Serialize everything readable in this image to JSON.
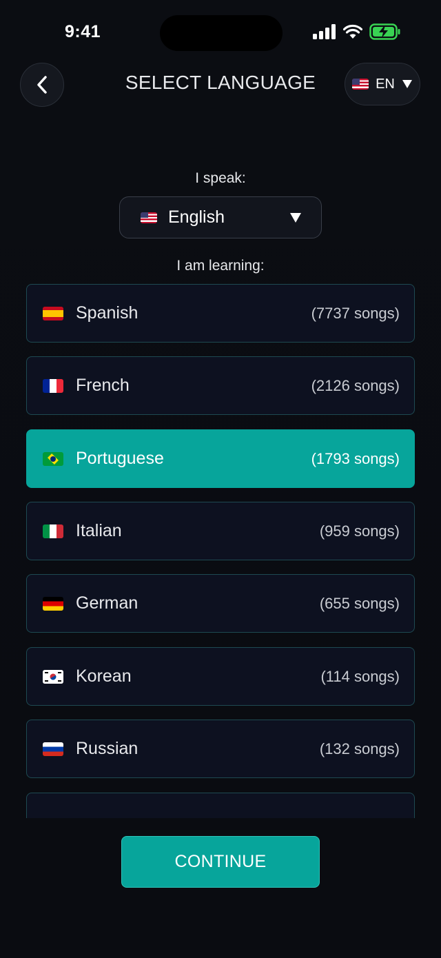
{
  "status_bar": {
    "time": "9:41"
  },
  "header": {
    "title": "SELECT LANGUAGE",
    "ui_language_code": "EN",
    "ui_language_flag": "us-flag"
  },
  "speak": {
    "label": "I speak:",
    "selected": "English",
    "flag": "us-flag"
  },
  "learning": {
    "label": "I am learning:",
    "items": [
      {
        "name": "Spanish",
        "count": "(7737 songs)",
        "flag": "es",
        "selected": false
      },
      {
        "name": "French",
        "count": "(2126 songs)",
        "flag": "fr",
        "selected": false
      },
      {
        "name": "Portuguese",
        "count": "(1793 songs)",
        "flag": "br",
        "selected": true
      },
      {
        "name": "Italian",
        "count": "(959 songs)",
        "flag": "it",
        "selected": false
      },
      {
        "name": "German",
        "count": "(655 songs)",
        "flag": "de",
        "selected": false
      },
      {
        "name": "Korean",
        "count": "(114 songs)",
        "flag": "kr",
        "selected": false
      },
      {
        "name": "Russian",
        "count": "(132 songs)",
        "flag": "ru",
        "selected": false
      },
      {
        "name": "",
        "count": "",
        "flag": "red",
        "selected": false
      }
    ]
  },
  "continue_label": "CONTINUE",
  "colors": {
    "accent": "#07a59b",
    "background": "#0b0d12",
    "card": "#0d1120",
    "card_border": "#1e4a52"
  }
}
